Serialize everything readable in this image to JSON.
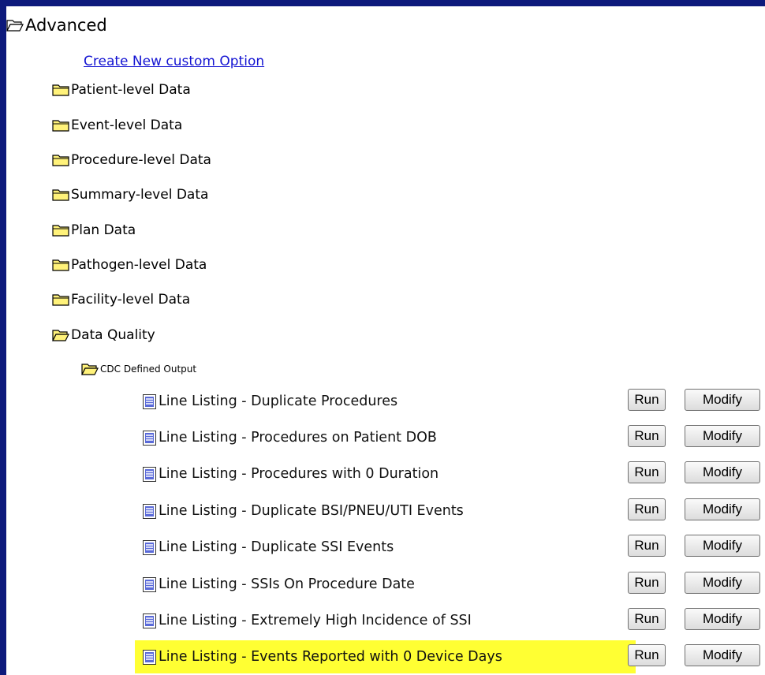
{
  "tree": {
    "root_label": "Advanced",
    "create_link": "Create New custom Option",
    "categories": [
      "Patient-level Data",
      "Event-level Data",
      "Procedure-level Data",
      "Summary-level Data",
      "Plan Data",
      "Pathogen-level Data",
      "Facility-level Data"
    ],
    "data_quality": "Data Quality",
    "cdc_defined": "CDC Defined Output",
    "reports": [
      "Line Listing - Duplicate Procedures",
      "Line Listing - Procedures on Patient DOB",
      "Line Listing - Procedures with 0 Duration",
      "Line Listing - Duplicate BSI/PNEU/UTI Events",
      "Line Listing - Duplicate SSI Events",
      "Line Listing - SSIs On Procedure Date",
      "Line Listing - Extremely High Incidence of SSI",
      "Line Listing - Events Reported with 0 Device Days"
    ],
    "highlighted_report_index": 7
  },
  "buttons": {
    "run": "Run",
    "modify": "Modify"
  },
  "colors": {
    "background": "#0d1a7c",
    "highlight": "#ffff33",
    "link": "#1414d2",
    "folder": "#fff27a"
  },
  "icons": {
    "open_folder": "folder-open-icon",
    "closed_folder": "folder-icon",
    "report": "report-document-icon"
  }
}
